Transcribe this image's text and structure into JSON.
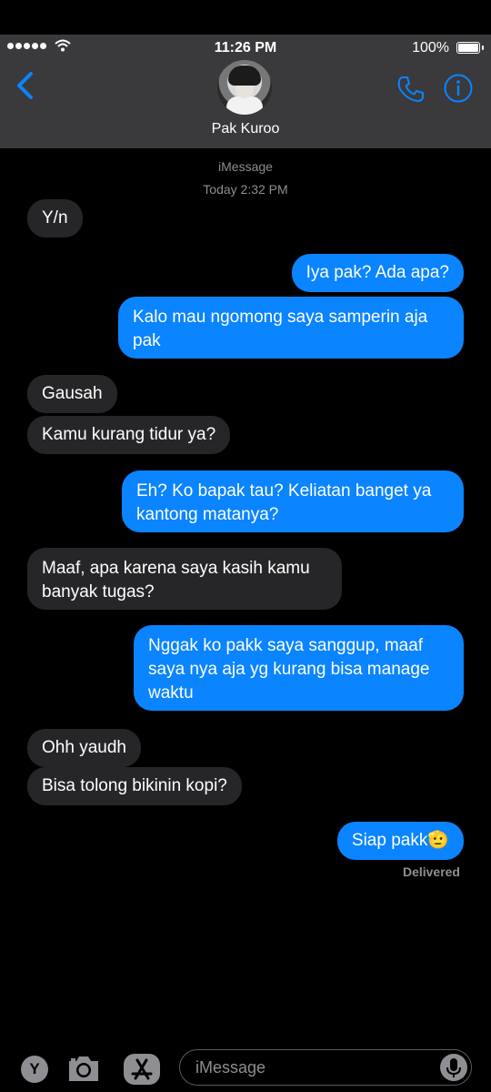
{
  "status_bar": {
    "time": "11:26 PM",
    "battery": "100%"
  },
  "header": {
    "contact_name": "Pak Kuroo"
  },
  "conversation": {
    "service": "iMessage",
    "timestamp": "Today 2:32 PM",
    "messages": [
      {
        "from": "them",
        "text": "Y/n"
      },
      {
        "from": "me",
        "text": "Iya pak? Ada apa?"
      },
      {
        "from": "me",
        "text": "Kalo mau ngomong saya samperin aja pak"
      },
      {
        "from": "them",
        "text": "Gausah"
      },
      {
        "from": "them",
        "text": "Kamu kurang tidur ya?"
      },
      {
        "from": "me",
        "text": "Eh? Ko bapak tau? Keliatan banget ya kantong matanya?"
      },
      {
        "from": "them",
        "text": "Maaf, apa karena saya kasih kamu banyak tugas?"
      },
      {
        "from": "me",
        "text": "Nggak ko pakk saya sanggup, maaf saya nya aja yg kurang bisa manage waktu"
      },
      {
        "from": "them",
        "text": "Ohh yaudh"
      },
      {
        "from": "them",
        "text": "Bisa tolong bikinin kopi?"
      },
      {
        "from": "me",
        "text": "Siap pakk🫡"
      }
    ],
    "delivered": "Delivered"
  },
  "composer": {
    "placeholder": "iMessage",
    "app_button": "Y"
  },
  "icons": [
    "back-chevron-icon",
    "phone-icon",
    "info-icon",
    "camera-icon",
    "app-store-icon",
    "mic-icon"
  ],
  "colors": {
    "outgoing": "#0a84ff",
    "incoming": "#262628",
    "accent": "#0a84ff"
  }
}
